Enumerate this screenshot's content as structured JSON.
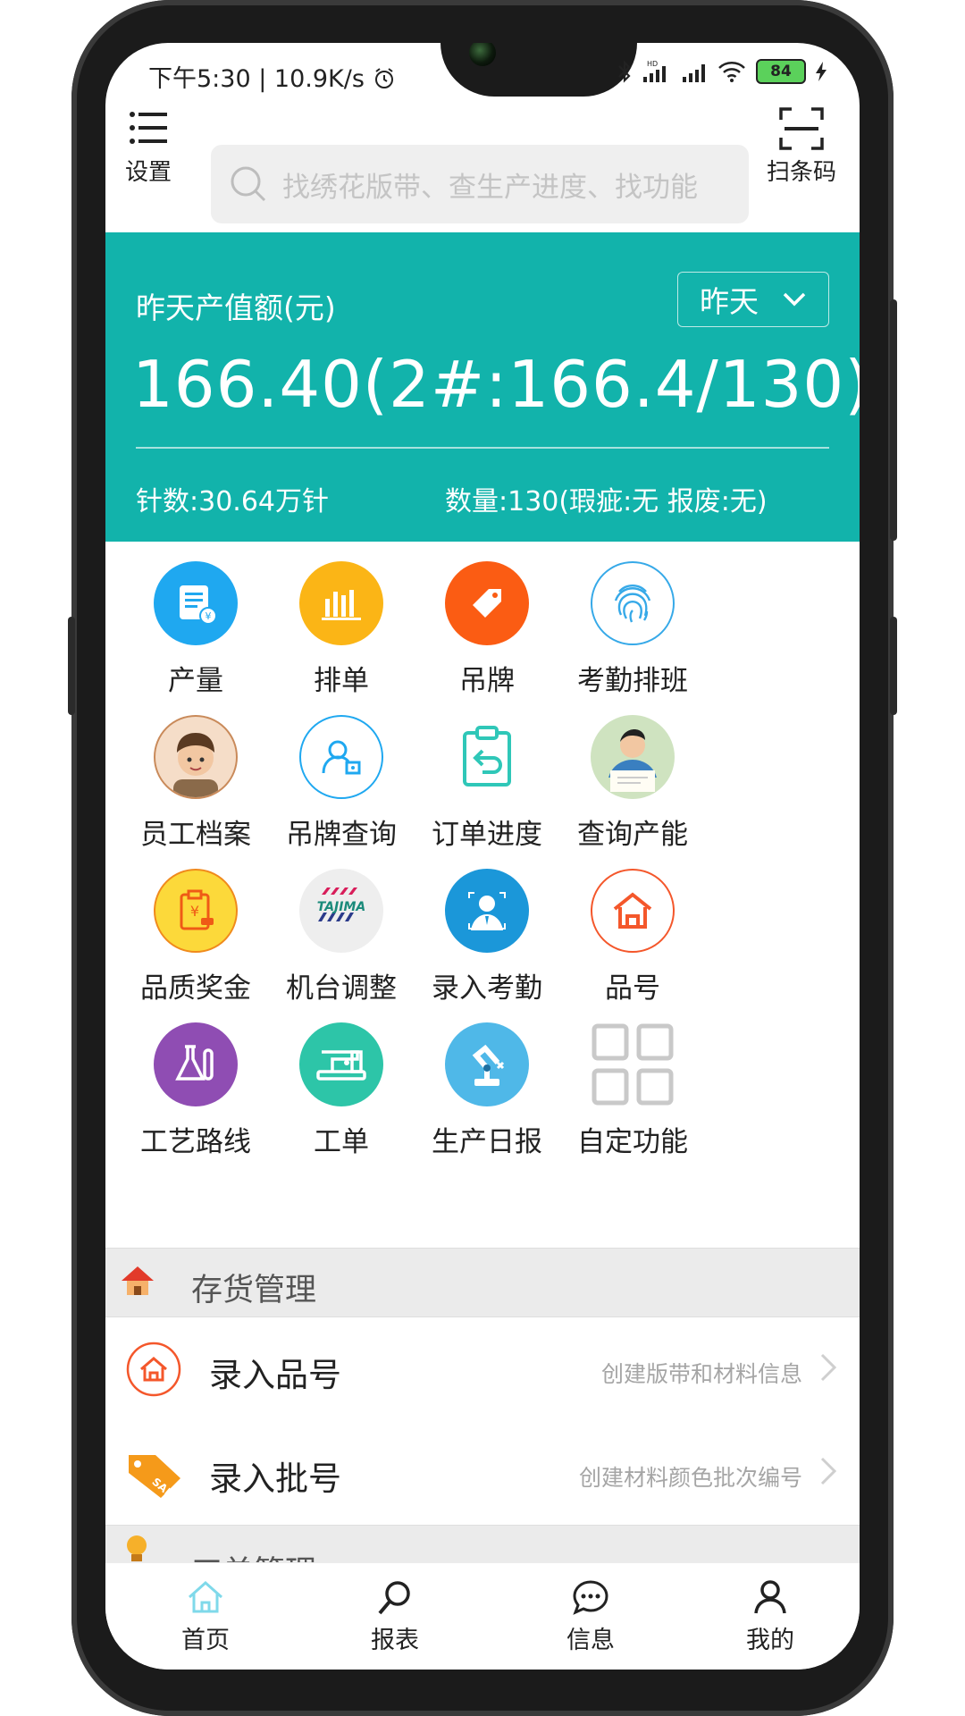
{
  "status_bar": {
    "time": "下午5:30",
    "speed": "10.9K/s",
    "battery": "84"
  },
  "toolbar": {
    "settings_label": "设置",
    "search_placeholder": "找绣花版带、查生产进度、找功能",
    "scan_label": "扫条码"
  },
  "summary": {
    "label": "昨天产值额(元)",
    "period": "昨天",
    "value": "166.40(2#:166.4/130)",
    "stitches": "针数:30.64万针",
    "quantity": "数量:130(瑕疵:无 报废:无)"
  },
  "features": [
    {
      "label": "产量",
      "icon": "output-icon",
      "color": "#1fa8f0"
    },
    {
      "label": "排单",
      "icon": "bar-chart-icon",
      "color": "#fbb516"
    },
    {
      "label": "吊牌",
      "icon": "tag-icon",
      "color": "#fb5c13"
    },
    {
      "label": "考勤排班",
      "icon": "fingerprint-icon",
      "color": "#36a9e8"
    },
    {
      "label": "员工档案",
      "icon": "employee-avatar-icon",
      "color": "#c98a5a"
    },
    {
      "label": "吊牌查询",
      "icon": "tag-search-icon",
      "color": "#1fa8f0"
    },
    {
      "label": "订单进度",
      "icon": "clipboard-return-icon",
      "color": "#2fc7b8"
    },
    {
      "label": "查询产能",
      "icon": "capacity-query-icon",
      "color": "#b8d8a8"
    },
    {
      "label": "品质奖金",
      "icon": "bonus-icon",
      "color": "#fcd93a"
    },
    {
      "label": "机台调整",
      "icon": "tajima-logo-icon",
      "color": "#eeeeee"
    },
    {
      "label": "录入考勤",
      "icon": "attendance-icon",
      "color": "#1b97d9"
    },
    {
      "label": "品号",
      "icon": "house-icon",
      "color": "#f4572b"
    },
    {
      "label": "工艺路线",
      "icon": "flask-icon",
      "color": "#8f4db3"
    },
    {
      "label": "工单",
      "icon": "sewing-machine-icon",
      "color": "#2dc5a8"
    },
    {
      "label": "生产日报",
      "icon": "robot-arm-icon",
      "color": "#4fb8e8"
    },
    {
      "label": "自定功能",
      "icon": "grid-icon",
      "color": "#c9c9c9"
    }
  ],
  "tajima_text": "TAJIMA",
  "inventory": {
    "title": "存货管理",
    "items": [
      {
        "title": "录入品号",
        "desc": "创建版带和材料信息"
      },
      {
        "title": "录入批号",
        "desc": "创建材料颜色批次编号"
      }
    ]
  },
  "workorder": {
    "title": "工单管理"
  },
  "nav": [
    {
      "label": "首页"
    },
    {
      "label": "报表"
    },
    {
      "label": "信息"
    },
    {
      "label": "我的"
    }
  ],
  "colors": {
    "accent": "#12b3ab",
    "nav_active": "#7fd9ea"
  }
}
